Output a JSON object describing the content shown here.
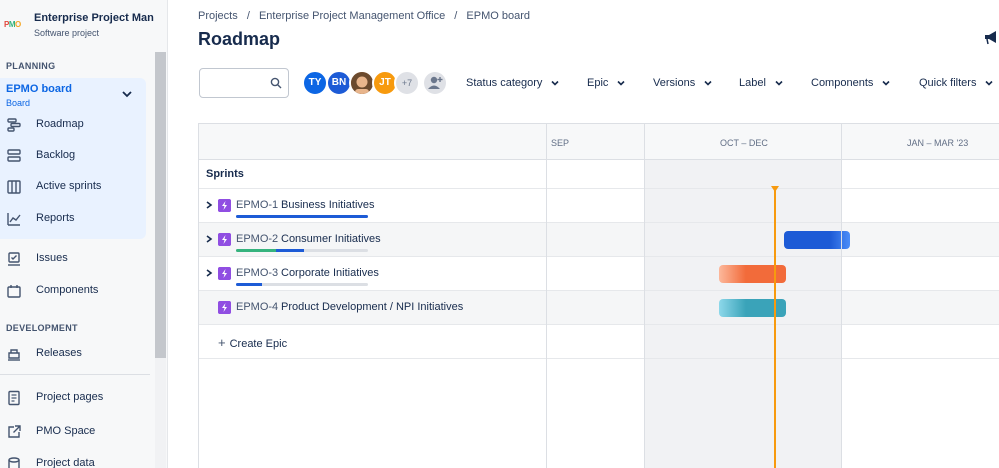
{
  "project": {
    "logo": "PMO",
    "name": "Enterprise Project Man...",
    "type": "Software project"
  },
  "sidebar": {
    "planning_label": "PLANNING",
    "board": {
      "title": "EPMO board",
      "subtitle": "Board"
    },
    "planning_items": [
      {
        "label": "Roadmap",
        "icon": "roadmap-icon"
      },
      {
        "label": "Backlog",
        "icon": "backlog-icon"
      },
      {
        "label": "Active sprints",
        "icon": "active-sprints-icon"
      },
      {
        "label": "Reports",
        "icon": "reports-icon"
      }
    ],
    "other_items": [
      {
        "label": "Issues",
        "icon": "issues-icon"
      },
      {
        "label": "Components",
        "icon": "components-icon"
      }
    ],
    "development_label": "DEVELOPMENT",
    "development_items": [
      {
        "label": "Releases",
        "icon": "releases-icon"
      }
    ],
    "footer_items": [
      {
        "label": "Project pages",
        "icon": "project-pages-icon"
      },
      {
        "label": "PMO Space",
        "icon": "external-link-icon"
      },
      {
        "label": "Project data",
        "icon": "project-data-icon"
      }
    ]
  },
  "breadcrumb": [
    "Projects",
    "/",
    "Enterprise Project Management Office",
    "/",
    "EPMO board"
  ],
  "page_title": "Roadmap",
  "avatars": [
    {
      "initials": "TY",
      "color": "#0c66e4"
    },
    {
      "initials": "BN",
      "color": "#1d5bd6"
    },
    {
      "initials": "",
      "color": "#c98a5c"
    },
    {
      "initials": "JT",
      "color": "#f79a0e"
    },
    {
      "initials": "+7",
      "color": "#dfe1e6"
    }
  ],
  "filters": [
    "Status category",
    "Epic",
    "Versions",
    "Label",
    "Components",
    "Quick filters"
  ],
  "timeline": {
    "months": [
      "SEP",
      "OCT – DEC",
      "JAN – MAR '23"
    ],
    "sprints_label": "Sprints",
    "epics": [
      {
        "key": "EPMO-1",
        "name": "Business Initiatives",
        "expandable": true,
        "progress": {
          "done": 1.0,
          "in_progress": 0.0
        }
      },
      {
        "key": "EPMO-2",
        "name": "Consumer Initiatives",
        "expandable": true,
        "progress": {
          "done": 0.3,
          "in_progress": 0.2
        },
        "bar_color": "#1d5bd6"
      },
      {
        "key": "EPMO-3",
        "name": "Corporate Initiatives",
        "expandable": true,
        "progress": {
          "done": 0.2,
          "in_progress": 0.0
        },
        "bar_color": "#f57d4f"
      },
      {
        "key": "EPMO-4",
        "name": "Product Development / NPI Initiatives",
        "expandable": false,
        "bar_color": "#3aa3b9"
      }
    ],
    "create_epic_label": "Create Epic"
  },
  "colors": {
    "accent": "#0c66e4",
    "today": "#f79a0e",
    "epic": "#904ee2",
    "done": "#36b37e"
  }
}
